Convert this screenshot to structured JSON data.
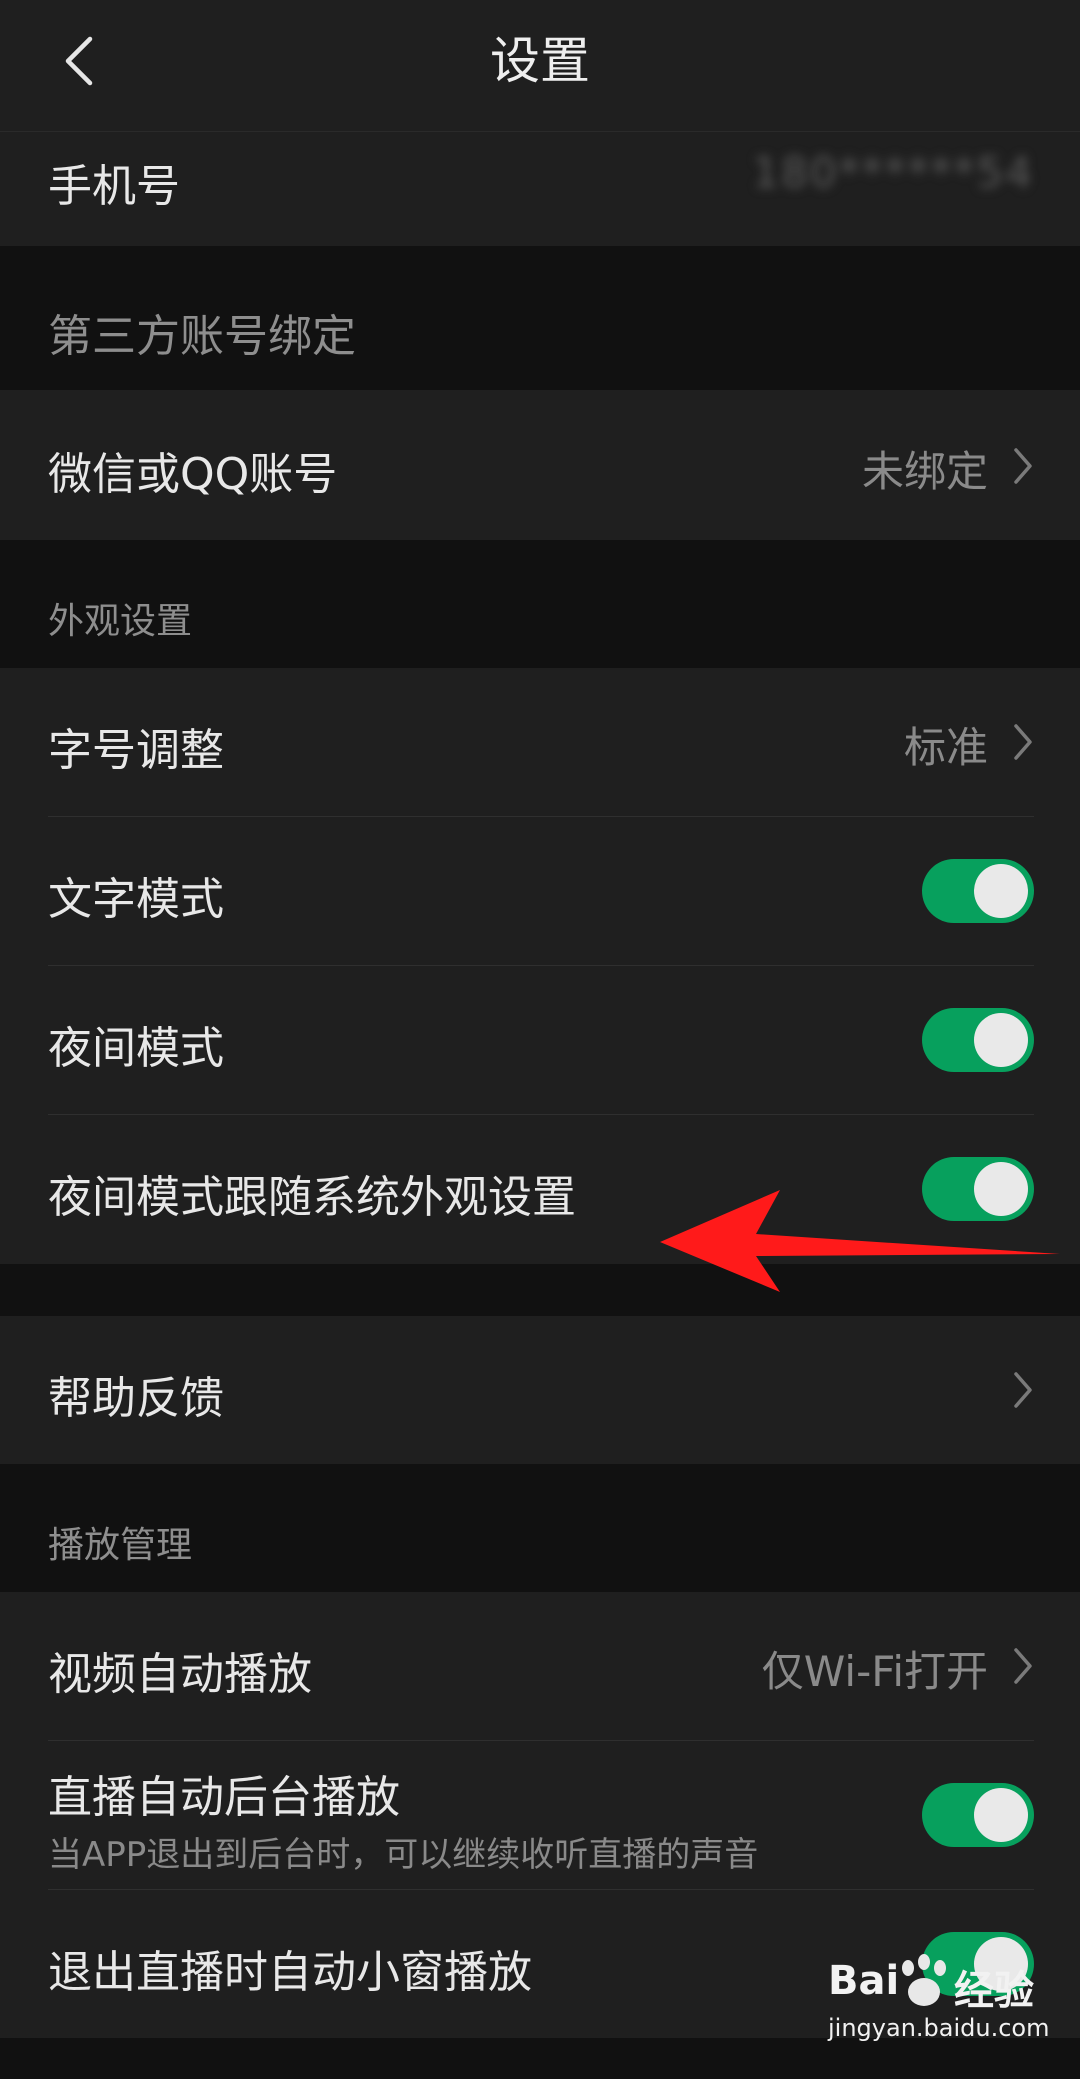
{
  "header": {
    "title": "设置"
  },
  "account": {
    "phone_label": "手机号",
    "phone_value": "180******54"
  },
  "sections": {
    "third_party": "第三方账号绑定",
    "appearance": "外观设置",
    "playback": "播放管理"
  },
  "rows": {
    "wechat_qq": {
      "label": "微信或QQ账号",
      "value": "未绑定"
    },
    "font_size": {
      "label": "字号调整",
      "value": "标准"
    },
    "text_mode": {
      "label": "文字模式",
      "on": true
    },
    "night_mode": {
      "label": "夜间模式",
      "on": true
    },
    "night_follow_system": {
      "label": "夜间模式跟随系统外观设置",
      "on": true
    },
    "help_feedback": {
      "label": "帮助反馈"
    },
    "video_autoplay": {
      "label": "视频自动播放",
      "value": "仅Wi-Fi打开"
    },
    "live_background": {
      "label": "直播自动后台播放",
      "sub": "当APP退出到后台时，可以继续收听直播的声音",
      "on": true
    },
    "live_mini_window": {
      "label": "退出直播时自动小窗播放",
      "on": true
    }
  },
  "watermark": {
    "brand": "Bai",
    "brand2": "经验",
    "url": "jingyan.baidu.com"
  },
  "colors": {
    "toggle_on": "#07a05d",
    "annotation_arrow": "#ff1a1a"
  }
}
